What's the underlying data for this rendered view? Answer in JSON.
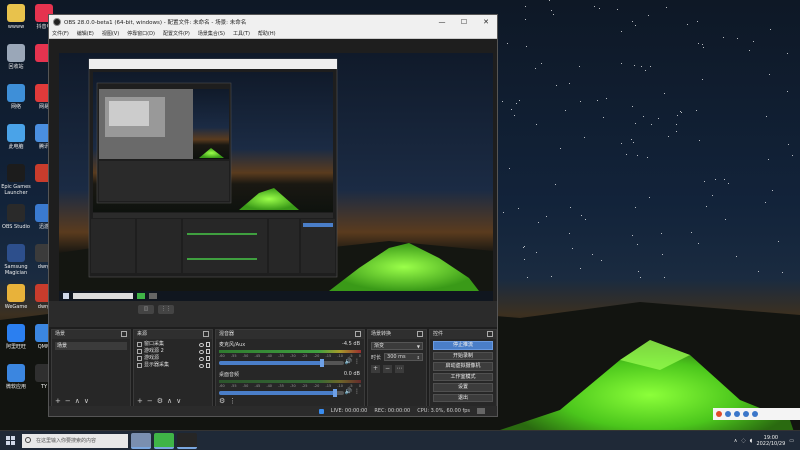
{
  "desktop": {
    "icons": [
      {
        "label": "wwww",
        "color": "#e8c24c"
      },
      {
        "label": "回收站",
        "color": "#9aa7b8"
      },
      {
        "label": "网络",
        "color": "#3e8fd8"
      },
      {
        "label": "此电脑",
        "color": "#4aa3e8"
      },
      {
        "label": "Epic Games Launcher",
        "color": "#1c1c1c"
      },
      {
        "label": "OBS Studio",
        "color": "#2a2a2a"
      },
      {
        "label": "Samsung Magician",
        "color": "#2d4f8c"
      },
      {
        "label": "WeGame",
        "color": "#e8b23a"
      },
      {
        "label": "阿里旺旺",
        "color": "#2b7ff0"
      },
      {
        "label": "微软应用",
        "color": "#3b86e0"
      }
    ],
    "icons_col2": [
      {
        "label": "抖音电",
        "color": "#e5334f"
      },
      {
        "label": "",
        "color": "#e5334f"
      },
      {
        "label": "网易",
        "color": "#e03a3a"
      },
      {
        "label": "腾讯",
        "color": "#4a8fe0"
      },
      {
        "label": "",
        "color": "#c83c2c"
      },
      {
        "label": "迅游",
        "color": "#3a7ad0"
      },
      {
        "label": "dwrg",
        "color": "#3b3b3b"
      },
      {
        "label": "dwrg",
        "color": "#c83c2c"
      },
      {
        "label": "QMM",
        "color": "#3b86e0"
      },
      {
        "label": "TY",
        "color": "#2f2f2f"
      }
    ]
  },
  "obs": {
    "title": "OBS 28.0.0-beta1 (64-bit, windows) - 配置文件: 未命名 - 场景: 未命名",
    "window_controls": [
      "—",
      "☐",
      "✕"
    ],
    "menu": [
      "文件(F)",
      "编辑(E)",
      "视图(V)",
      "停靠窗口(D)",
      "配置文件(P)",
      "场景集合(S)",
      "工具(T)",
      "帮助(H)"
    ],
    "preview_buttons": [
      "◫",
      "⋮⋮"
    ],
    "scenes": {
      "header": "场景",
      "items": [
        "场景"
      ],
      "footer": [
        "+",
        "−",
        "∧",
        "∨"
      ]
    },
    "sources": {
      "header": "来源",
      "items": [
        {
          "label": "窗口采集",
          "icon": "window-capture-icon"
        },
        {
          "label": "游戏源 2",
          "icon": "game-capture-icon"
        },
        {
          "label": "游戏源",
          "icon": "game-capture-icon"
        },
        {
          "label": "显示器采集",
          "icon": "display-capture-icon"
        }
      ],
      "footer": [
        "+",
        "−",
        "⚙",
        "∧",
        "∨"
      ]
    },
    "mixer": {
      "header": "混音器",
      "channels": [
        {
          "name": "麦克风/Aux",
          "db": "-4.5 dB",
          "level": 0.82,
          "active": true
        },
        {
          "name": "桌面音频",
          "db": "0.0 dB",
          "level": 0.93,
          "active": false
        }
      ],
      "scale": [
        "-60",
        "-55",
        "-50",
        "-45",
        "-40",
        "-35",
        "-30",
        "-25",
        "-20",
        "-15",
        "-10",
        "-5",
        "0"
      ],
      "footer": [
        "⚙",
        "⋮"
      ]
    },
    "transitions": {
      "header": "场景转换",
      "type": "渐变",
      "duration_label": "时长",
      "duration": "300 ms",
      "buttons": [
        "+",
        "−",
        "⋯"
      ]
    },
    "controls": {
      "header": "控件",
      "buttons": [
        "停止推流",
        "开始录制",
        "启动虚拟摄像机",
        "工作室模式",
        "设置",
        "退出"
      ]
    },
    "status": {
      "live": "LIVE: 00:00:00",
      "rec": "REC: 00:00:00",
      "cpu": "CPU: 3.0%, 60.00 fps"
    }
  },
  "taskbar": {
    "search_placeholder": "在这里输入你要搜索的内容",
    "apps": [
      {
        "name": "file-explorer-app",
        "color": "#7a8fb0"
      },
      {
        "name": "wechat-app",
        "color": "#3fb447"
      },
      {
        "name": "obs-app",
        "color": "#262626"
      }
    ],
    "time": "19:00",
    "date": "2022/10/29"
  },
  "colors": {
    "accent": "#4a7ec8",
    "tent": "#5bd626"
  }
}
